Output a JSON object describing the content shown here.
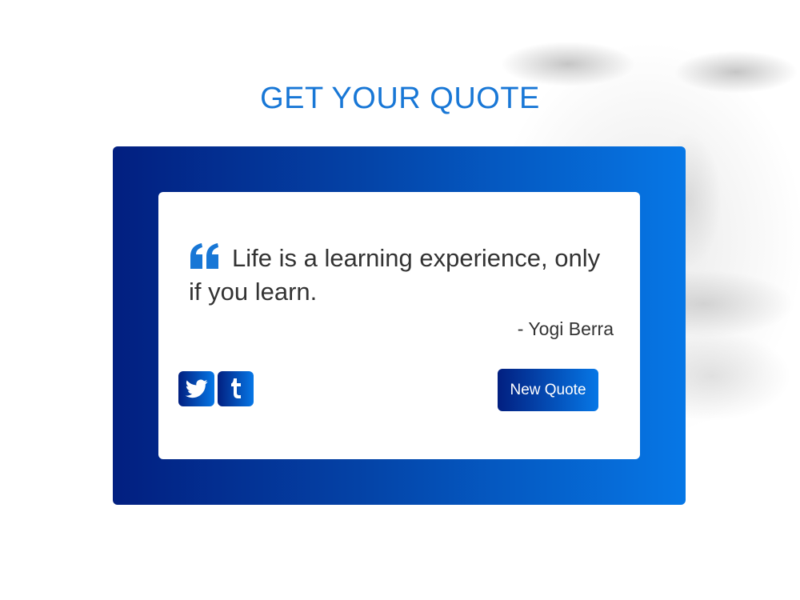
{
  "header": {
    "title": "GET YOUR QUOTE"
  },
  "quote": {
    "text": "Life is a learning experience, only if you learn.",
    "author": "- Yogi Berra",
    "icon": "quote-left-icon"
  },
  "share": {
    "twitter_icon": "twitter-icon",
    "tumblr_icon": "tumblr-icon"
  },
  "actions": {
    "new_quote_label": "New Quote"
  },
  "colors": {
    "title": "#1877d6",
    "gradient_start": "#021f80",
    "gradient_end": "#0677e6",
    "text": "#333333"
  }
}
